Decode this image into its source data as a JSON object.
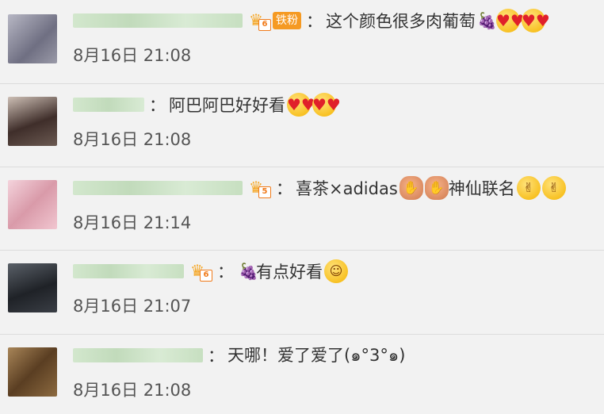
{
  "comments": [
    {
      "vip_level": "6",
      "fan_badge": "铁粉",
      "separator": "：",
      "text_before": "这个颜色很多肉葡萄",
      "text_after": "",
      "emojis": [
        "grape-icon",
        "heart-eyes-emoji",
        "heart-eyes-emoji"
      ],
      "time": "8月16日 21:08",
      "avatar_color": "#8a8a9a",
      "name_color": "#c9e3c3"
    },
    {
      "separator": "：",
      "text_before": "阿巴阿巴好好看",
      "emojis": [
        "heart-eyes-emoji",
        "heart-eyes-emoji"
      ],
      "time": "8月16日 21:08",
      "avatar_color": "#4a3a36",
      "name_color": "#c9e3c3"
    },
    {
      "vip_level": "5",
      "separator": "：",
      "text_before": "喜茶×adidas",
      "text_after": "神仙联名",
      "emojis_mid": [
        "pray-hands-emoji",
        "pray-hands-emoji"
      ],
      "emojis": [
        "laugh-emoji",
        "laugh-emoji"
      ],
      "time": "8月16日 21:14",
      "avatar_color": "#e8b9c4",
      "name_color": "#c9e3c3"
    },
    {
      "vip_level": "6",
      "separator": "：",
      "text_before": "有点好看",
      "emojis_lead": [
        "grape-icon"
      ],
      "emojis": [
        "grin-emoji"
      ],
      "time": "8月16日 21:07",
      "avatar_color": "#2a2d33",
      "name_color": "#c9e3c3"
    },
    {
      "separator": "：",
      "text_before": "天哪！爱了爱了(๑°3°๑)",
      "time": "8月16日 21:08",
      "avatar_color": "#7a5a38",
      "name_color": "#c9e3c3"
    }
  ]
}
